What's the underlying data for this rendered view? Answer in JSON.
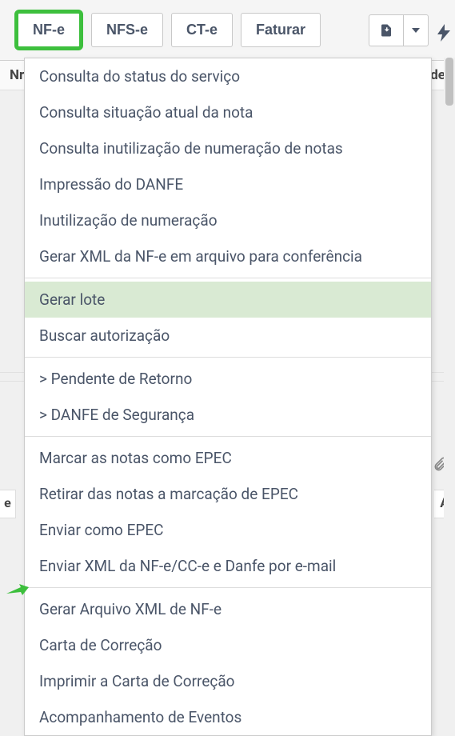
{
  "toolbar": {
    "nfe_label": "NF-e",
    "nfse_label": "NFS-e",
    "cte_label": "CT-e",
    "faturar_label": "Faturar"
  },
  "header": {
    "left_col": "Nr",
    "right_col": "de"
  },
  "menu": {
    "items": [
      {
        "label": "Consulta do status do serviço",
        "highlighted": false
      },
      {
        "label": "Consulta situação atual da nota",
        "highlighted": false
      },
      {
        "label": "Consulta inutilização de numeração de notas",
        "highlighted": false
      },
      {
        "label": "Impressão do DANFE",
        "highlighted": false
      },
      {
        "label": "Inutilização de numeração",
        "highlighted": false
      },
      {
        "label": "Gerar XML da NF-e em arquivo para conferência",
        "highlighted": false
      }
    ],
    "group2": [
      {
        "label": "Gerar lote",
        "highlighted": true
      },
      {
        "label": "Buscar autorização",
        "highlighted": false
      }
    ],
    "group3": [
      {
        "label": "> Pendente de Retorno"
      },
      {
        "label": "> DANFE de Segurança"
      }
    ],
    "group4": [
      {
        "label": "Marcar as notas como EPEC"
      },
      {
        "label": "Retirar das notas a marcação de EPEC"
      },
      {
        "label": "Enviar como EPEC"
      },
      {
        "label": "Enviar XML da NF-e/CC-e e Danfe por e-mail"
      }
    ],
    "group5": [
      {
        "label": "Gerar Arquivo XML de NF-e"
      },
      {
        "label": "Carta de Correção"
      },
      {
        "label": "Imprimir a Carta de Correção"
      },
      {
        "label": "Acompanhamento de Eventos"
      }
    ]
  },
  "bottom": {
    "left": "e",
    "right": "A"
  }
}
